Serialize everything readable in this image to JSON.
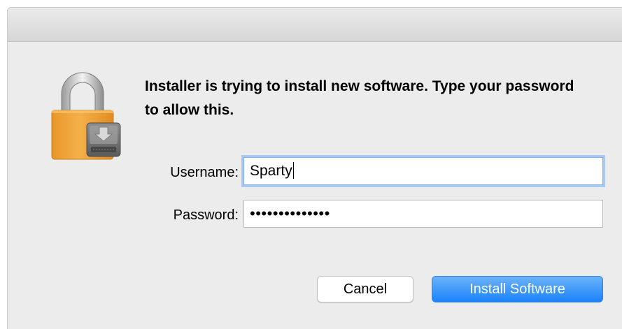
{
  "dialog": {
    "message": "Installer is trying to install new software. Type your password to allow this.",
    "username_label": "Username:",
    "username_value": "Sparty",
    "password_label": "Password:",
    "password_display": "••••••••••••••",
    "cancel_label": "Cancel",
    "install_label": "Install Software"
  },
  "icons": {
    "lock": "padlock-with-installer-disk-icon"
  },
  "colors": {
    "accent": "#1a82fb",
    "lock_body": "#f0a53b",
    "background": "#ececec"
  }
}
